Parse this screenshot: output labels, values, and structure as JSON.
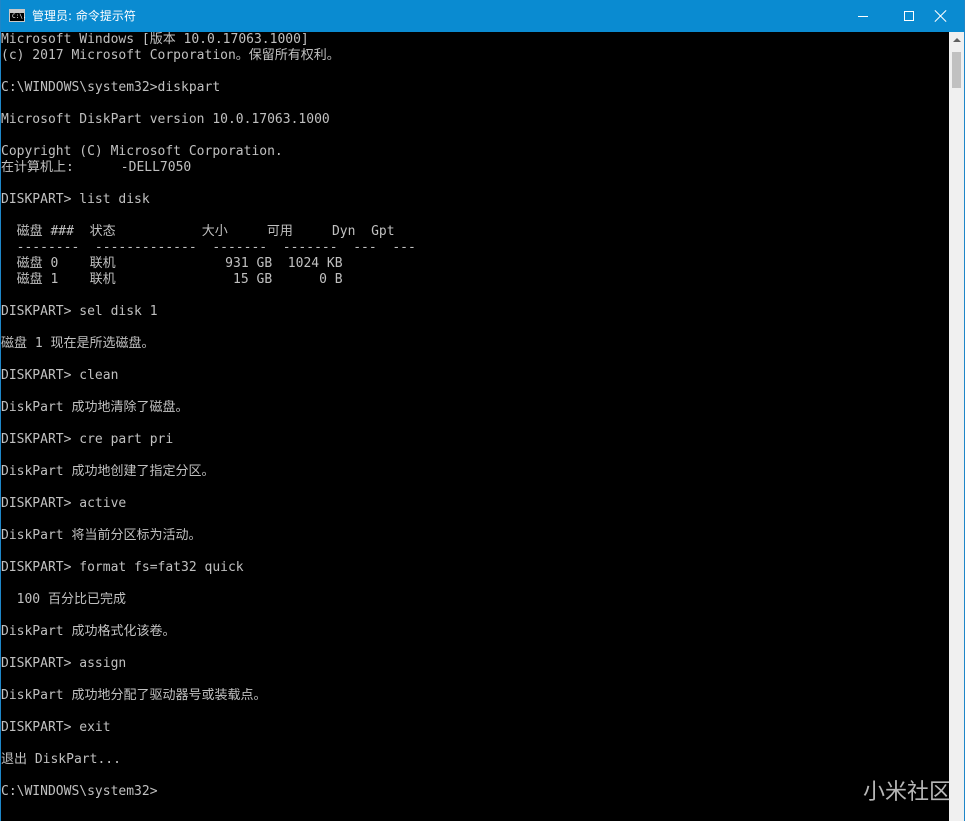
{
  "window": {
    "title": "管理员: 命令提示符",
    "icon_text": "C:\\."
  },
  "colors": {
    "titlebar_bg": "#0a8bd1",
    "console_bg": "#000000",
    "console_text": "#c0c0c0"
  },
  "console": {
    "lines": [
      "Microsoft Windows [版本 10.0.17063.1000]",
      "(c) 2017 Microsoft Corporation。保留所有权利。",
      "",
      "C:\\WINDOWS\\system32>diskpart",
      "",
      "Microsoft DiskPart version 10.0.17063.1000",
      "",
      "Copyright (C) Microsoft Corporation.",
      "在计算机上:      -DELL7050",
      "",
      "DISKPART> list disk",
      "",
      "  磁盘 ###  状态           大小     可用     Dyn  Gpt",
      "  --------  -------------  -------  -------  ---  ---",
      "  磁盘 0    联机              931 GB  1024 KB",
      "  磁盘 1    联机               15 GB      0 B",
      "",
      "DISKPART> sel disk 1",
      "",
      "磁盘 1 现在是所选磁盘。",
      "",
      "DISKPART> clean",
      "",
      "DiskPart 成功地清除了磁盘。",
      "",
      "DISKPART> cre part pri",
      "",
      "DiskPart 成功地创建了指定分区。",
      "",
      "DISKPART> active",
      "",
      "DiskPart 将当前分区标为活动。",
      "",
      "DISKPART> format fs=fat32 quick",
      "",
      "  100 百分比已完成",
      "",
      "DiskPart 成功格式化该卷。",
      "",
      "DISKPART> assign",
      "",
      "DiskPart 成功地分配了驱动器号或装载点。",
      "",
      "DISKPART> exit",
      "",
      "退出 DiskPart...",
      "",
      "C:\\WINDOWS\\system32>"
    ]
  },
  "watermark": "小米社区"
}
